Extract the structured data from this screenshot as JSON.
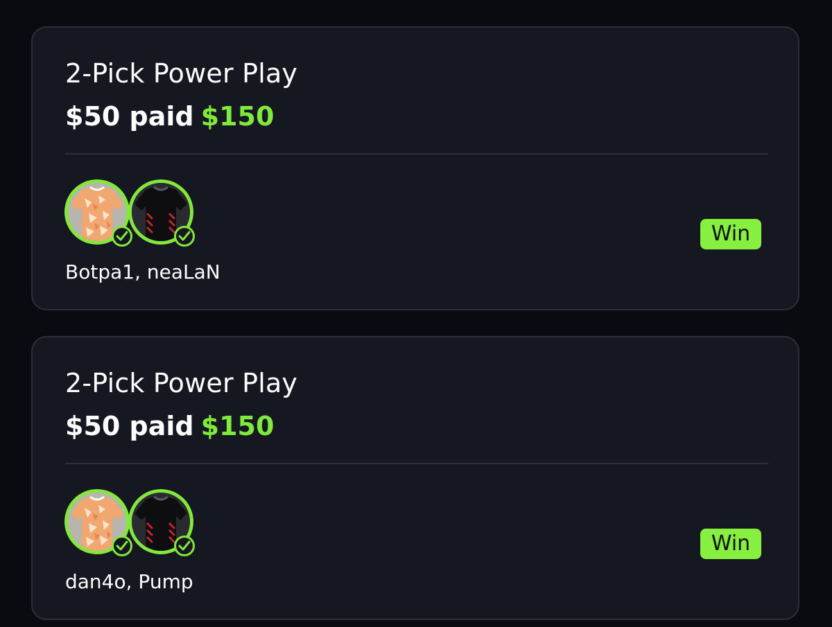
{
  "colors": {
    "background": "#0a0b10",
    "card": "#161821",
    "accent_green": "#7fea3b",
    "win_badge": "#86ef3f"
  },
  "entries": [
    {
      "title": "2-Pick Power Play",
      "paid": "$50 paid",
      "payout": "$150",
      "picks": [
        {
          "jersey": "orange-patterned-jersey-icon",
          "status": "check-icon"
        },
        {
          "jersey": "black-red-jersey-icon",
          "status": "check-icon"
        }
      ],
      "names": "Botpa1, neaLaN",
      "result": "Win"
    },
    {
      "title": "2-Pick Power Play",
      "paid": "$50 paid",
      "payout": "$150",
      "picks": [
        {
          "jersey": "orange-patterned-jersey-icon",
          "status": "check-icon"
        },
        {
          "jersey": "black-red-jersey-icon",
          "status": "check-icon"
        }
      ],
      "names": "dan4o, Pump",
      "result": "Win"
    }
  ]
}
